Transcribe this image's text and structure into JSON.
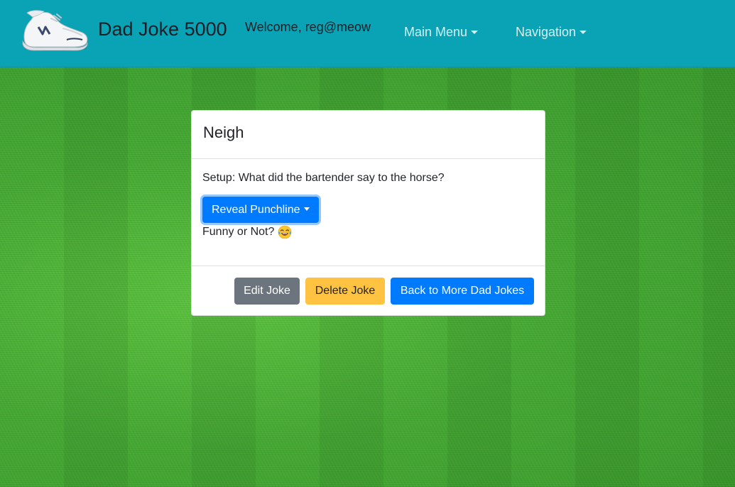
{
  "navbar": {
    "brand_title": "Dad Joke 5000",
    "welcome_text": "Welcome, reg@meow",
    "menu_main_label": "Main Menu",
    "menu_navigation_label": "Navigation",
    "bg_color": "#0aa2b5"
  },
  "joke": {
    "title": "Neigh",
    "setup_text": "Setup: What did the bartender say to the horse?",
    "reveal_label": "Reveal Punchline",
    "funny_prompt": "Funny or Not?",
    "funny_icon": "tears-of-joy-emoji-icon"
  },
  "actions": {
    "edit_label": "Edit Joke",
    "delete_label": "Delete Joke",
    "back_label": "Back to More Dad Jokes"
  },
  "colors": {
    "primary": "#007bff",
    "secondary": "#6c757d",
    "warning": "#ffc341"
  }
}
